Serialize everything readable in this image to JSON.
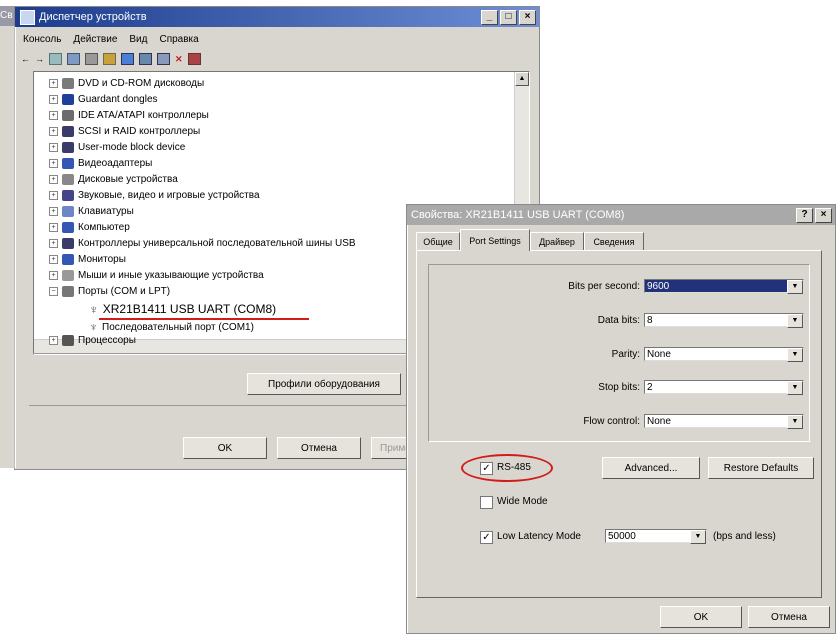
{
  "device_manager": {
    "title": "Диспетчер устройств",
    "left_stub": "Св",
    "menu": [
      "Консоль",
      "Действие",
      "Вид",
      "Справка"
    ],
    "tree": [
      {
        "label": "DVD и CD-ROM дисководы",
        "color": "#7a7a7a"
      },
      {
        "label": "Guardant dongles",
        "color": "#1f3f9a"
      },
      {
        "label": "IDE ATA/ATAPI контроллеры",
        "color": "#6c6c6c"
      },
      {
        "label": "SCSI и RAID контроллеры",
        "color": "#3b3b6b"
      },
      {
        "label": "User-mode block device",
        "color": "#3b3b6b"
      },
      {
        "label": "Видеоадаптеры",
        "color": "#3456b4"
      },
      {
        "label": "Дисковые устройства",
        "color": "#888888"
      },
      {
        "label": "Звуковые, видео и игровые устройства",
        "color": "#444488"
      },
      {
        "label": "Клавиатуры",
        "color": "#6c86c8"
      },
      {
        "label": "Компьютер",
        "color": "#3456b4"
      },
      {
        "label": "Контроллеры универсальной последовательной шины USB",
        "color": "#3b3b6b"
      },
      {
        "label": "Мониторы",
        "color": "#3456b4"
      },
      {
        "label": "Мыши и иные указывающие устройства",
        "color": "#999999"
      },
      {
        "label": "Порты (COM и LPT)",
        "color": "#777777"
      }
    ],
    "port_child_1": "XR21B1411 USB UART (COM8)",
    "port_child_2": "Последовательный порт (COM1)",
    "processors": "Процессоры",
    "profiles_button": "Профили оборудования",
    "ok_button": "OK",
    "cancel_button": "Отмена",
    "apply_button": "Примен"
  },
  "properties": {
    "title": "Свойства: XR21B1411 USB UART (COM8)",
    "help_btn": "?",
    "close_btn": "×",
    "tabs": [
      "Общие",
      "Port Settings",
      "Драйвер",
      "Сведения"
    ],
    "fields": [
      {
        "label": "Bits per second:",
        "value": "9600"
      },
      {
        "label": "Data bits:",
        "value": "8"
      },
      {
        "label": "Parity:",
        "value": "None"
      },
      {
        "label": "Stop bits:",
        "value": "2"
      },
      {
        "label": "Flow control:",
        "value": "None"
      }
    ],
    "rs485": {
      "label": "RS-485",
      "checked": true
    },
    "advanced_button": "Advanced...",
    "restore_button": "Restore Defaults",
    "wide_mode": {
      "label": "Wide Mode",
      "checked": false
    },
    "low_latency": {
      "label": "Low Latency Mode",
      "checked": true,
      "value": "50000",
      "suffix": "(bps and less)"
    },
    "ok_button": "OK",
    "cancel_button": "Отмена"
  },
  "colors": {
    "highlight_red": "#d21c1c",
    "selection_blue": "#22327a"
  }
}
